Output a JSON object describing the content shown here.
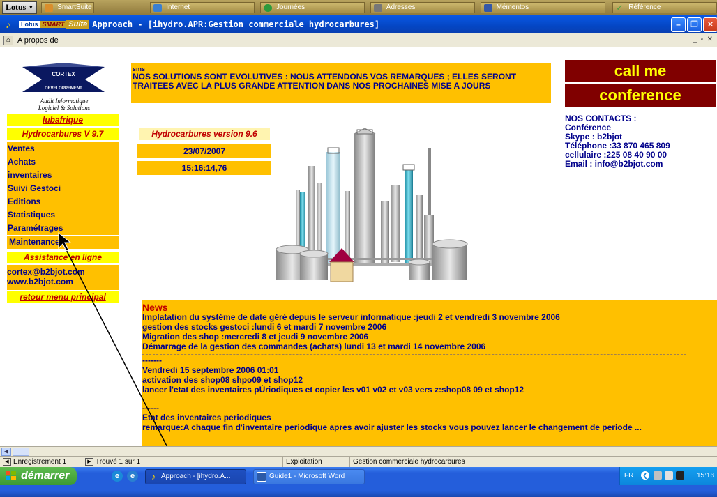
{
  "suitebar": {
    "lotus_label": "Lotus",
    "tabs": [
      {
        "label": "SmartSuite",
        "icon": "smartsuite-icon",
        "color": "#d98e2c"
      },
      {
        "label": "Internet",
        "icon": "internet-icon",
        "color": "#3a7fd0"
      },
      {
        "label": "Journées",
        "icon": "globe-icon",
        "color": "#2c9a3c"
      },
      {
        "label": "Adresses",
        "icon": "address-book-icon",
        "color": "#777777"
      },
      {
        "label": "Mémentos",
        "icon": "memo-icon",
        "color": "#3458a8"
      },
      {
        "label": "Référence",
        "icon": "checkmark-icon",
        "color": "#4aa040"
      }
    ]
  },
  "titlebar": {
    "logo_lotus": "Lotus",
    "logo_smart": "SMART",
    "logo_suite": "Suite",
    "title": "Approach - [ihydro.APR:Gestion commerciale hydrocarbures]"
  },
  "menubar": {
    "item": "A propos de"
  },
  "logo": {
    "name": "CORTEX",
    "subtitle": "DEVELOPPEMENT",
    "tagline1": "Audit Informatique",
    "tagline2": "Logiciel & Solutions"
  },
  "sidebar": {
    "company_link": "lubafrique",
    "product": "Hydrocarbures V 9.7",
    "items": [
      "Ventes",
      "Achats",
      "inventaires",
      "Suivi Gestoci",
      "Editions",
      "Statistiques",
      "Paramétrages",
      "Maintenance"
    ],
    "assistance": "Assistance en ligne",
    "email": "cortex@b2bjot.com",
    "website": "www.b2bjot.com",
    "return_link": "retour menu principal"
  },
  "sms": {
    "label": "sms",
    "text": "NOS SOLUTIONS SONT EVOLUTIVES : NOUS ATTENDONS VOS REMARQUES ; ELLES SERONT TRAITEES AVEC LA PLUS GRANDE ATTENTION DANS NOS PROCHAINES MISE A JOURS"
  },
  "buttons": {
    "call_me": "call me",
    "conference": "conference"
  },
  "contacts": {
    "heading": "NOS CONTACTS :",
    "line1": "Conférence",
    "line2": "Skype : b2bjot",
    "line3": "Téléphone :33 870 465 809",
    "line4": "cellulaire  :225 08 40 90 00",
    "line5": "Email : info@b2bjot.com"
  },
  "info": {
    "version": "Hydrocarbures version 9.6",
    "date": "23/07/2007",
    "time": "15:16:14,76"
  },
  "news": {
    "heading": "News",
    "lines1": [
      "Implatation du systéme de date géré depuis le serveur informatique :jeudi 2 et vendredi 3 novembre 2006",
      "gestion des stocks gestoci :lundi  6 et mardi 7 novembre 2006",
      "Migration des shop :mercredi 8 et jeudi 9 novembre 2006",
      "Démarrage de la gestion des commandes (achats)  lundi 13 et mardi 14 novembre 2006"
    ],
    "dashes": "-------",
    "lines2": [
      "Vendredi 15 septembre 2006  01:01",
      "activation des shop08 shpo09 et shop12",
      "lancer l'etat des inventaires pÙriodiques et copier les v01 v02 et v03 vers z:shop08 09 et shop12"
    ],
    "dashes2": "------",
    "lines3": [
      "Etat des inventaires periodiques",
      "remarque:A chaque fin d'inventaire periodique apres avoir ajuster les stocks vous pouvez lancer le changement de periode ..."
    ]
  },
  "status": {
    "record": "Enregistrement 1",
    "found": "Trouvé 1 sur 1",
    "mode": "Exploitation",
    "form": "Gestion commerciale hydrocarbures"
  },
  "taskbar": {
    "start": "démarrer",
    "tasks": [
      "Approach - [ihydro.A...",
      "Guide1 - Microsoft Word"
    ],
    "lang": "FR",
    "clock": "15:16"
  },
  "colors": {
    "panel": "#ffc000",
    "highlight": "#ffff00",
    "text": "#00008b",
    "accent_red": "#c00000",
    "callme_bg": "#800000"
  }
}
